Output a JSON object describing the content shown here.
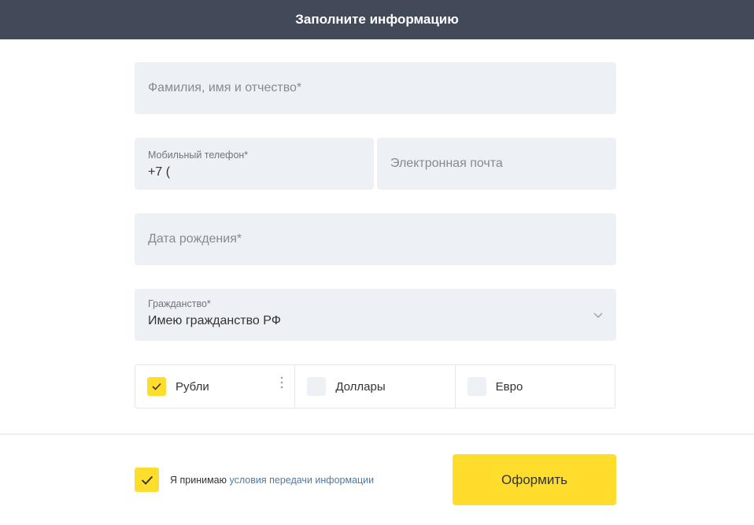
{
  "header": {
    "title": "Заполните информацию"
  },
  "fields": {
    "full_name": {
      "placeholder": "Фамилия, имя и отчество*"
    },
    "phone": {
      "label": "Мобильный телефон*",
      "value": "+7 ("
    },
    "email": {
      "placeholder": "Электронная почта"
    },
    "birth_date": {
      "placeholder": "Дата рождения*"
    },
    "citizenship": {
      "label": "Гражданство*",
      "value": "Имею гражданство РФ"
    }
  },
  "currencies": [
    {
      "label": "Рубли",
      "checked": true
    },
    {
      "label": "Доллары",
      "checked": false
    },
    {
      "label": "Евро",
      "checked": false
    }
  ],
  "agreement": {
    "checked": true,
    "text": "Я принимаю",
    "link_text": "условия передачи информации"
  },
  "submit": {
    "label": "Оформить"
  },
  "colors": {
    "header_bg": "#424a59",
    "field_bg": "#edf1f5",
    "accent_yellow": "#ffdd2d",
    "link": "#4c7ba8"
  }
}
